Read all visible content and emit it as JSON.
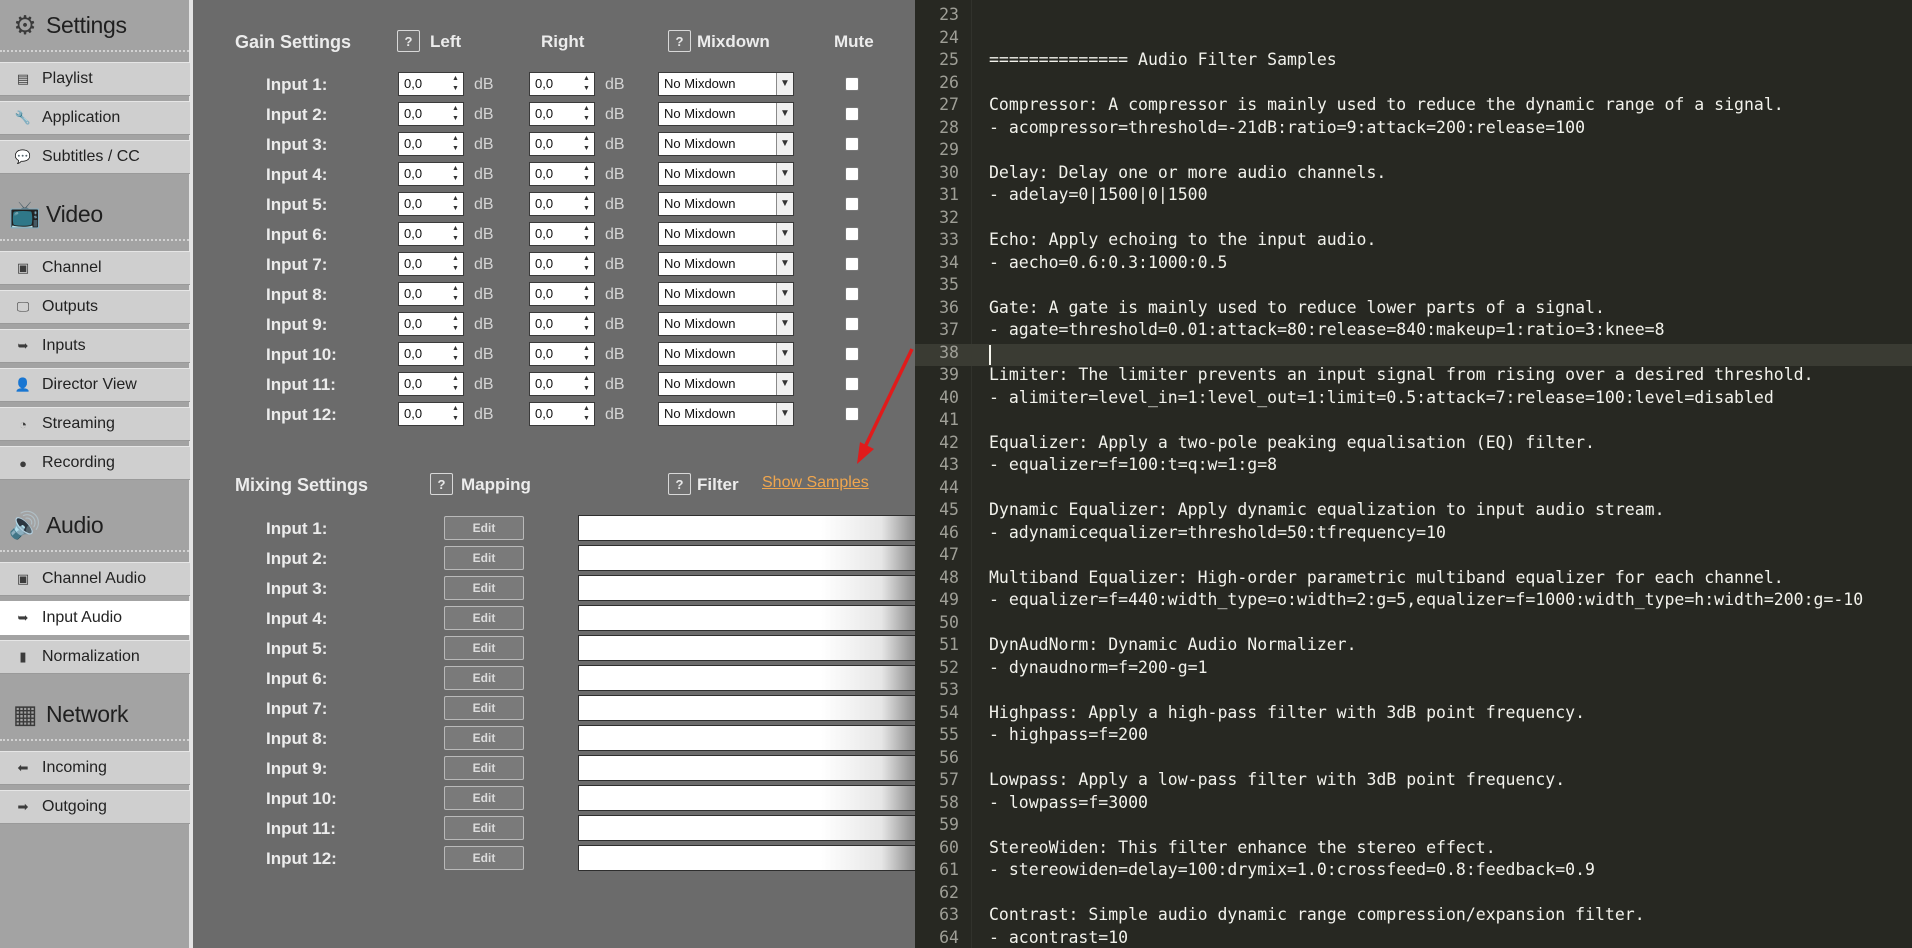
{
  "sidebar": {
    "sections": [
      {
        "title": "Settings",
        "icon": "gear-icon",
        "items": [
          {
            "label": "Playlist",
            "icon": "playlist-icon"
          },
          {
            "label": "Application",
            "icon": "wrench-icon"
          },
          {
            "label": "Subtitles / CC",
            "icon": "subtitles-icon"
          }
        ]
      },
      {
        "title": "Video",
        "icon": "tv-icon",
        "items": [
          {
            "label": "Channel",
            "icon": "channel-icon"
          },
          {
            "label": "Outputs",
            "icon": "monitor-icon"
          },
          {
            "label": "Inputs",
            "icon": "input-icon"
          },
          {
            "label": "Director View",
            "icon": "person-icon"
          },
          {
            "label": "Streaming",
            "icon": "rss-icon"
          },
          {
            "label": "Recording",
            "icon": "record-dot-icon"
          }
        ]
      },
      {
        "title": "Audio",
        "icon": "speaker-icon",
        "items": [
          {
            "label": "Channel Audio",
            "icon": "channel-icon"
          },
          {
            "label": "Input Audio",
            "icon": "input-icon",
            "active": true
          },
          {
            "label": "Normalization",
            "icon": "bar-chart-icon"
          }
        ]
      },
      {
        "title": "Network",
        "icon": "network-icon",
        "items": [
          {
            "label": "Incoming",
            "icon": "arrow-left-icon"
          },
          {
            "label": "Outgoing",
            "icon": "arrow-right-icon"
          }
        ]
      }
    ]
  },
  "gain": {
    "title": "Gain Settings",
    "help": "?",
    "col_left": "Left",
    "col_right": "Right",
    "col_mixdown": "Mixdown",
    "col_mute": "Mute",
    "unit": "dB",
    "rows": [
      {
        "label": "Input 1:",
        "left": "0,0",
        "right": "0,0",
        "mixdown": "No Mixdown",
        "mute": false
      },
      {
        "label": "Input 2:",
        "left": "0,0",
        "right": "0,0",
        "mixdown": "No Mixdown",
        "mute": false
      },
      {
        "label": "Input 3:",
        "left": "0,0",
        "right": "0,0",
        "mixdown": "No Mixdown",
        "mute": false
      },
      {
        "label": "Input 4:",
        "left": "0,0",
        "right": "0,0",
        "mixdown": "No Mixdown",
        "mute": false
      },
      {
        "label": "Input 5:",
        "left": "0,0",
        "right": "0,0",
        "mixdown": "No Mixdown",
        "mute": false
      },
      {
        "label": "Input 6:",
        "left": "0,0",
        "right": "0,0",
        "mixdown": "No Mixdown",
        "mute": false
      },
      {
        "label": "Input 7:",
        "left": "0,0",
        "right": "0,0",
        "mixdown": "No Mixdown",
        "mute": false
      },
      {
        "label": "Input 8:",
        "left": "0,0",
        "right": "0,0",
        "mixdown": "No Mixdown",
        "mute": false
      },
      {
        "label": "Input 9:",
        "left": "0,0",
        "right": "0,0",
        "mixdown": "No Mixdown",
        "mute": false
      },
      {
        "label": "Input 10:",
        "left": "0,0",
        "right": "0,0",
        "mixdown": "No Mixdown",
        "mute": false
      },
      {
        "label": "Input 11:",
        "left": "0,0",
        "right": "0,0",
        "mixdown": "No Mixdown",
        "mute": false
      },
      {
        "label": "Input 12:",
        "left": "0,0",
        "right": "0,0",
        "mixdown": "No Mixdown",
        "mute": false
      }
    ]
  },
  "mixing": {
    "title": "Mixing Settings",
    "help": "?",
    "col_mapping": "Mapping",
    "col_filter": "Filter",
    "show_samples": "Show Samples",
    "edit_label": "Edit",
    "rows": [
      {
        "label": "Input 1:",
        "filter": ""
      },
      {
        "label": "Input 2:",
        "filter": ""
      },
      {
        "label": "Input 3:",
        "filter": ""
      },
      {
        "label": "Input 4:",
        "filter": ""
      },
      {
        "label": "Input 5:",
        "filter": ""
      },
      {
        "label": "Input 6:",
        "filter": ""
      },
      {
        "label": "Input 7:",
        "filter": ""
      },
      {
        "label": "Input 8:",
        "filter": ""
      },
      {
        "label": "Input 9:",
        "filter": ""
      },
      {
        "label": "Input 10:",
        "filter": ""
      },
      {
        "label": "Input 11:",
        "filter": ""
      },
      {
        "label": "Input 12:",
        "filter": ""
      }
    ]
  },
  "editor": {
    "current_line": 38,
    "lines": [
      {
        "n": "23",
        "t": ""
      },
      {
        "n": "24",
        "t": ""
      },
      {
        "n": "25",
        "t": "============== Audio Filter Samples"
      },
      {
        "n": "26",
        "t": ""
      },
      {
        "n": "27",
        "t": "Compressor: A compressor is mainly used to reduce the dynamic range of a signal."
      },
      {
        "n": "28",
        "t": "- acompressor=threshold=-21dB:ratio=9:attack=200:release=100"
      },
      {
        "n": "29",
        "t": ""
      },
      {
        "n": "30",
        "t": "Delay: Delay one or more audio channels."
      },
      {
        "n": "31",
        "t": "- adelay=0|1500|0|1500"
      },
      {
        "n": "32",
        "t": ""
      },
      {
        "n": "33",
        "t": "Echo: Apply echoing to the input audio."
      },
      {
        "n": "34",
        "t": "- aecho=0.6:0.3:1000:0.5"
      },
      {
        "n": "35",
        "t": ""
      },
      {
        "n": "36",
        "t": "Gate: A gate is mainly used to reduce lower parts of a signal."
      },
      {
        "n": "37",
        "t": "- agate=threshold=0.01:attack=80:release=840:makeup=1:ratio=3:knee=8"
      },
      {
        "n": "38",
        "t": ""
      },
      {
        "n": "39",
        "t": "Limiter: The limiter prevents an input signal from rising over a desired threshold."
      },
      {
        "n": "40",
        "t": "- alimiter=level_in=1:level_out=1:limit=0.5:attack=7:release=100:level=disabled"
      },
      {
        "n": "41",
        "t": ""
      },
      {
        "n": "42",
        "t": "Equalizer: Apply a two-pole peaking equalisation (EQ) filter."
      },
      {
        "n": "43",
        "t": "- equalizer=f=100:t=q:w=1:g=8"
      },
      {
        "n": "44",
        "t": ""
      },
      {
        "n": "45",
        "t": "Dynamic Equalizer: Apply dynamic equalization to input audio stream."
      },
      {
        "n": "46",
        "t": "- adynamicequalizer=threshold=50:tfrequency=10"
      },
      {
        "n": "47",
        "t": ""
      },
      {
        "n": "48",
        "t": "Multiband Equalizer: High-order parametric multiband equalizer for each channel."
      },
      {
        "n": "49",
        "t": "- equalizer=f=440:width_type=o:width=2:g=5,equalizer=f=1000:width_type=h:width=200:g=-10"
      },
      {
        "n": "50",
        "t": ""
      },
      {
        "n": "51",
        "t": "DynAudNorm: Dynamic Audio Normalizer."
      },
      {
        "n": "52",
        "t": "- dynaudnorm=f=200-g=1"
      },
      {
        "n": "53",
        "t": ""
      },
      {
        "n": "54",
        "t": "Highpass: Apply a high-pass filter with 3dB point frequency."
      },
      {
        "n": "55",
        "t": "- highpass=f=200"
      },
      {
        "n": "56",
        "t": ""
      },
      {
        "n": "57",
        "t": "Lowpass: Apply a low-pass filter with 3dB point frequency."
      },
      {
        "n": "58",
        "t": "- lowpass=f=3000"
      },
      {
        "n": "59",
        "t": ""
      },
      {
        "n": "60",
        "t": "StereoWiden: This filter enhance the stereo effect."
      },
      {
        "n": "61",
        "t": "- stereowiden=delay=100:drymix=1.0:crossfeed=0.8:feedback=0.9"
      },
      {
        "n": "62",
        "t": ""
      },
      {
        "n": "63",
        "t": "Contrast: Simple audio dynamic range compression/expansion filter."
      },
      {
        "n": "64",
        "t": "- acontrast=10"
      }
    ]
  },
  "colors": {
    "sidebar_bg": "#a3a3a3",
    "panel_bg": "#6b6b6b",
    "editor_bg": "#272822",
    "link": "#f0a64e",
    "annotation_arrow": "#e01b1b"
  }
}
